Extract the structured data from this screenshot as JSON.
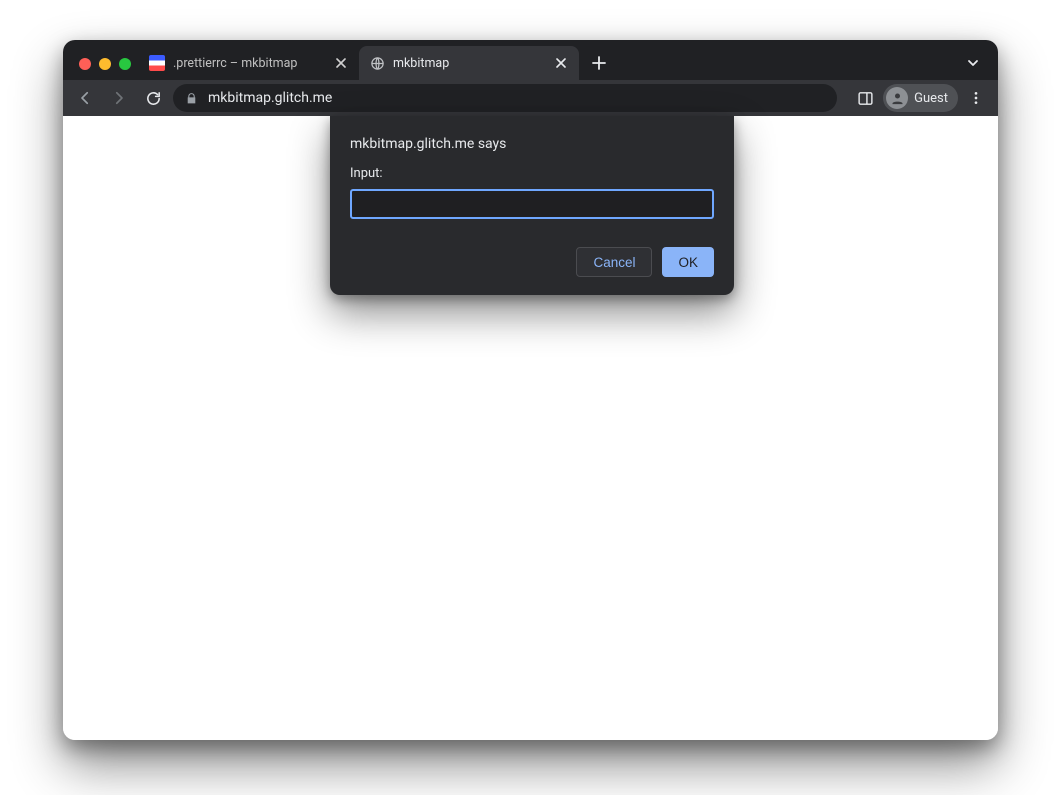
{
  "tabs": [
    {
      "title": ".prettierrc – mkbitmap",
      "active": false,
      "favicon": "glitch"
    },
    {
      "title": "mkbitmap",
      "active": true,
      "favicon": "globe"
    }
  ],
  "toolbar": {
    "url": "mkbitmap.glitch.me",
    "guest_label": "Guest"
  },
  "dialog": {
    "origin_text": "mkbitmap.glitch.me says",
    "prompt_label": "Input:",
    "input_value": "",
    "cancel_label": "Cancel",
    "ok_label": "OK"
  },
  "colors": {
    "accent_blue": "#8ab4f8",
    "focus_ring": "#6fa7ff",
    "chrome_dark": "#202124",
    "toolbar_dark": "#35363a",
    "dialog_bg": "#292a2d"
  }
}
